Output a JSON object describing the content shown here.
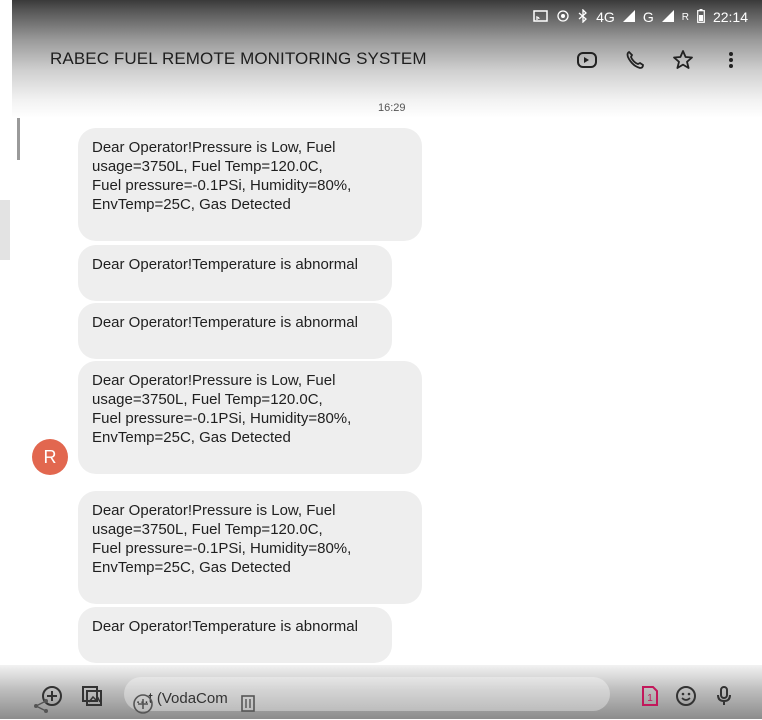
{
  "status_bar": {
    "network": "4G",
    "network2": "G",
    "roaming": "R",
    "time": "22:14"
  },
  "header": {
    "title": "RABEC FUEL REMOTE MONITORING SYSTEM"
  },
  "thread": {
    "timestamp": "16:29",
    "avatar_letter": "R",
    "messages": [
      {
        "lines": [
          "Dear Operator!Pressure is Low, Fuel",
          "usage=3750L, Fuel Temp=120.0C,",
          "Fuel pressure=-0.1PSi, Humidity=80%,",
          "EnvTemp=25C, Gas Detected"
        ]
      },
      {
        "lines": [
          "Dear Operator!Temperature is abnormal"
        ]
      },
      {
        "lines": [
          "Dear Operator!Temperature is abnormal"
        ]
      },
      {
        "lines": [
          "Dear Operator!Pressure is Low, Fuel",
          "usage=3750L, Fuel Temp=120.0C,",
          "Fuel pressure=-0.1PSi, Humidity=80%,",
          "EnvTemp=25C, Gas Detected"
        ]
      },
      {
        "lines": [
          "Dear Operator!Pressure is Low, Fuel",
          "usage=3750L, Fuel Temp=120.0C,",
          "Fuel pressure=-0.1PSi, Humidity=80%,",
          "EnvTemp=25C, Gas Detected"
        ]
      },
      {
        "lines": [
          "Dear Operator!Temperature is abnormal"
        ]
      }
    ]
  },
  "composer": {
    "text": "...t (VodaCom",
    "sim_badge": "1"
  },
  "icons": {
    "header": [
      "video-call-icon",
      "phone-icon",
      "star-icon",
      "more-vert-icon"
    ],
    "composer": [
      "add-icon",
      "gallery-icon",
      "sim-icon",
      "emoji-icon",
      "mic-icon"
    ]
  },
  "colors": {
    "avatar": "#e2674f",
    "bubble": "#eeeeee",
    "sim": "#c2185b"
  }
}
